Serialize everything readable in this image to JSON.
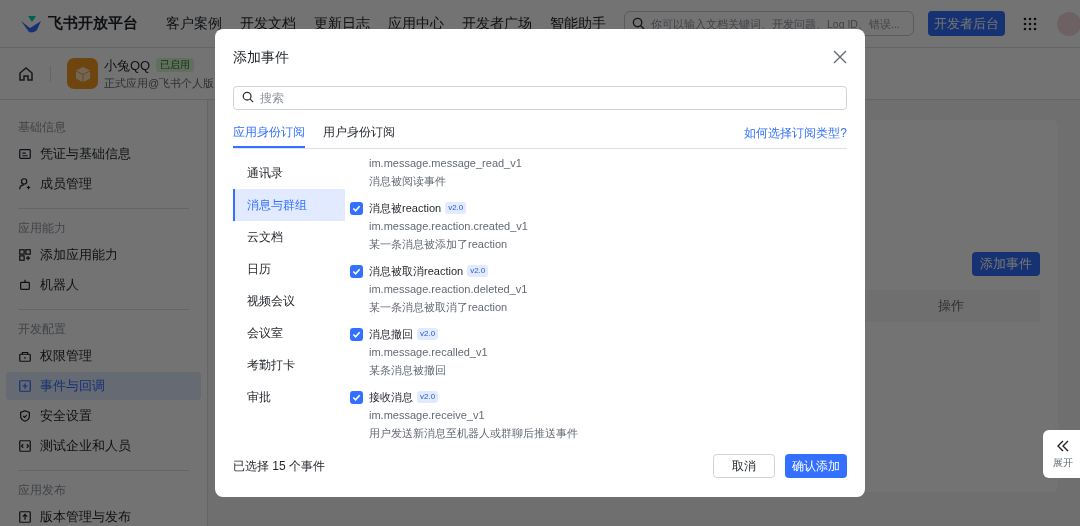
{
  "top_nav": {
    "brand": "飞书开放平台",
    "links": [
      "客户案例",
      "开发文档",
      "更新日志",
      "应用中心",
      "开发者广场",
      "智能助手"
    ],
    "search": {
      "placeholder": "你可以输入文档关键词、开发问题、Log ID、错误..."
    },
    "console_button": "开发者后台"
  },
  "app_header": {
    "name": "小兔QQ",
    "badge": "已启用",
    "subtitle": "正式应用@飞书个人版"
  },
  "sidebar": {
    "sections": [
      {
        "title": "基础信息",
        "items": [
          {
            "label": "凭证与基础信息",
            "selected": false
          },
          {
            "label": "成员管理",
            "selected": false
          }
        ]
      },
      {
        "title": "应用能力",
        "items": [
          {
            "label": "添加应用能力",
            "selected": false
          },
          {
            "label": "机器人",
            "selected": false
          }
        ]
      },
      {
        "title": "开发配置",
        "items": [
          {
            "label": "权限管理",
            "selected": false
          },
          {
            "label": "事件与回调",
            "selected": true
          },
          {
            "label": "安全设置",
            "selected": false
          },
          {
            "label": "测试企业和人员",
            "selected": false
          }
        ]
      },
      {
        "title": "应用发布",
        "items": [
          {
            "label": "版本管理与发布",
            "selected": false
          }
        ]
      }
    ]
  },
  "content": {
    "add_button": "添加事件",
    "table": {
      "columns": [
        "操作"
      ]
    }
  },
  "expand_tab": {
    "label": "展开"
  },
  "dialog": {
    "title": "添加事件",
    "search": {
      "placeholder": "搜索"
    },
    "tabs": [
      {
        "label": "应用身份订阅",
        "selected": true
      },
      {
        "label": "用户身份订阅",
        "selected": false
      }
    ],
    "help_link": "如何选择订阅类型?",
    "categories": [
      {
        "label": "通讯录",
        "selected": false
      },
      {
        "label": "消息与群组",
        "selected": true
      },
      {
        "label": "云文档",
        "selected": false
      },
      {
        "label": "日历",
        "selected": false
      },
      {
        "label": "视频会议",
        "selected": false
      },
      {
        "label": "会议室",
        "selected": false
      },
      {
        "label": "考勤打卡",
        "selected": false
      },
      {
        "label": "审批",
        "selected": false
      }
    ],
    "events": [
      {
        "code": "im.message.message_read_v1",
        "description": "消息被阅读事件"
      },
      {
        "name": "消息被reaction",
        "version": "v2.0",
        "checked": true,
        "code": "im.message.reaction.created_v1",
        "description": "某一条消息被添加了reaction"
      },
      {
        "name": "消息被取消reaction",
        "version": "v2.0",
        "checked": true,
        "code": "im.message.reaction.deleted_v1",
        "description": "某一条消息被取消了reaction"
      },
      {
        "name": "消息撤回",
        "version": "v2.0",
        "checked": true,
        "code": "im.message.recalled_v1",
        "description": "某条消息被撤回"
      },
      {
        "name": "接收消息",
        "version": "v2.0",
        "checked": true,
        "code": "im.message.receive_v1",
        "description": "用户发送新消息至机器人或群聊后推送事件"
      }
    ],
    "selected_count": "已选择 15 个事件",
    "cancel": "取消",
    "confirm": "确认添加"
  }
}
